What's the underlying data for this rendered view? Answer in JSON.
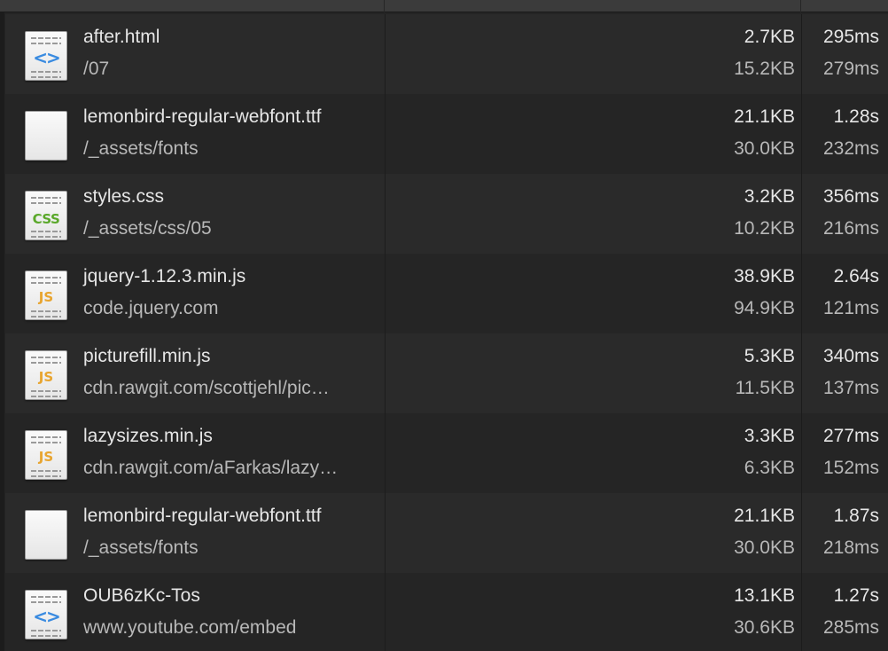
{
  "requests": [
    {
      "name": "after.html",
      "path": "/07",
      "size": "2.7KB",
      "transferred": "15.2KB",
      "time": "295ms",
      "latency": "279ms",
      "icon": "html-file-icon",
      "badge": "<>",
      "badge_type": "html"
    },
    {
      "name": "lemonbird-regular-webfont.ttf",
      "path": "/_assets/fonts",
      "size": "21.1KB",
      "transferred": "30.0KB",
      "time": "1.28s",
      "latency": "232ms",
      "icon": "font-file-icon",
      "badge": "",
      "badge_type": "font"
    },
    {
      "name": "styles.css",
      "path": "/_assets/css/05",
      "size": "3.2KB",
      "transferred": "10.2KB",
      "time": "356ms",
      "latency": "216ms",
      "icon": "css-file-icon",
      "badge": "CSS",
      "badge_type": "css"
    },
    {
      "name": "jquery-1.12.3.min.js",
      "path": "code.jquery.com",
      "size": "38.9KB",
      "transferred": "94.9KB",
      "time": "2.64s",
      "latency": "121ms",
      "icon": "js-file-icon",
      "badge": "JS",
      "badge_type": "js"
    },
    {
      "name": "picturefill.min.js",
      "path": "cdn.rawgit.com/scottjehl/pic…",
      "size": "5.3KB",
      "transferred": "11.5KB",
      "time": "340ms",
      "latency": "137ms",
      "icon": "js-file-icon",
      "badge": "JS",
      "badge_type": "js"
    },
    {
      "name": "lazysizes.min.js",
      "path": "cdn.rawgit.com/aFarkas/lazy…",
      "size": "3.3KB",
      "transferred": "6.3KB",
      "time": "277ms",
      "latency": "152ms",
      "icon": "js-file-icon",
      "badge": "JS",
      "badge_type": "js"
    },
    {
      "name": "lemonbird-regular-webfont.ttf",
      "path": "/_assets/fonts",
      "size": "21.1KB",
      "transferred": "30.0KB",
      "time": "1.87s",
      "latency": "218ms",
      "icon": "font-file-icon",
      "badge": "",
      "badge_type": "font"
    },
    {
      "name": "OUB6zKc-Tos",
      "path": "www.youtube.com/embed",
      "size": "13.1KB",
      "transferred": "30.6KB",
      "time": "1.27s",
      "latency": "285ms",
      "icon": "html-file-icon",
      "badge": "<>",
      "badge_type": "html"
    }
  ],
  "colors": {
    "background": "#242424",
    "row_odd": "#2a2a2a",
    "row_even": "#252525",
    "text_primary": "#e6e6e6",
    "text_secondary": "#b8b8b8",
    "html_badge": "#3a8be0",
    "css_badge": "#5aa82a",
    "js_badge": "#e8a530"
  }
}
